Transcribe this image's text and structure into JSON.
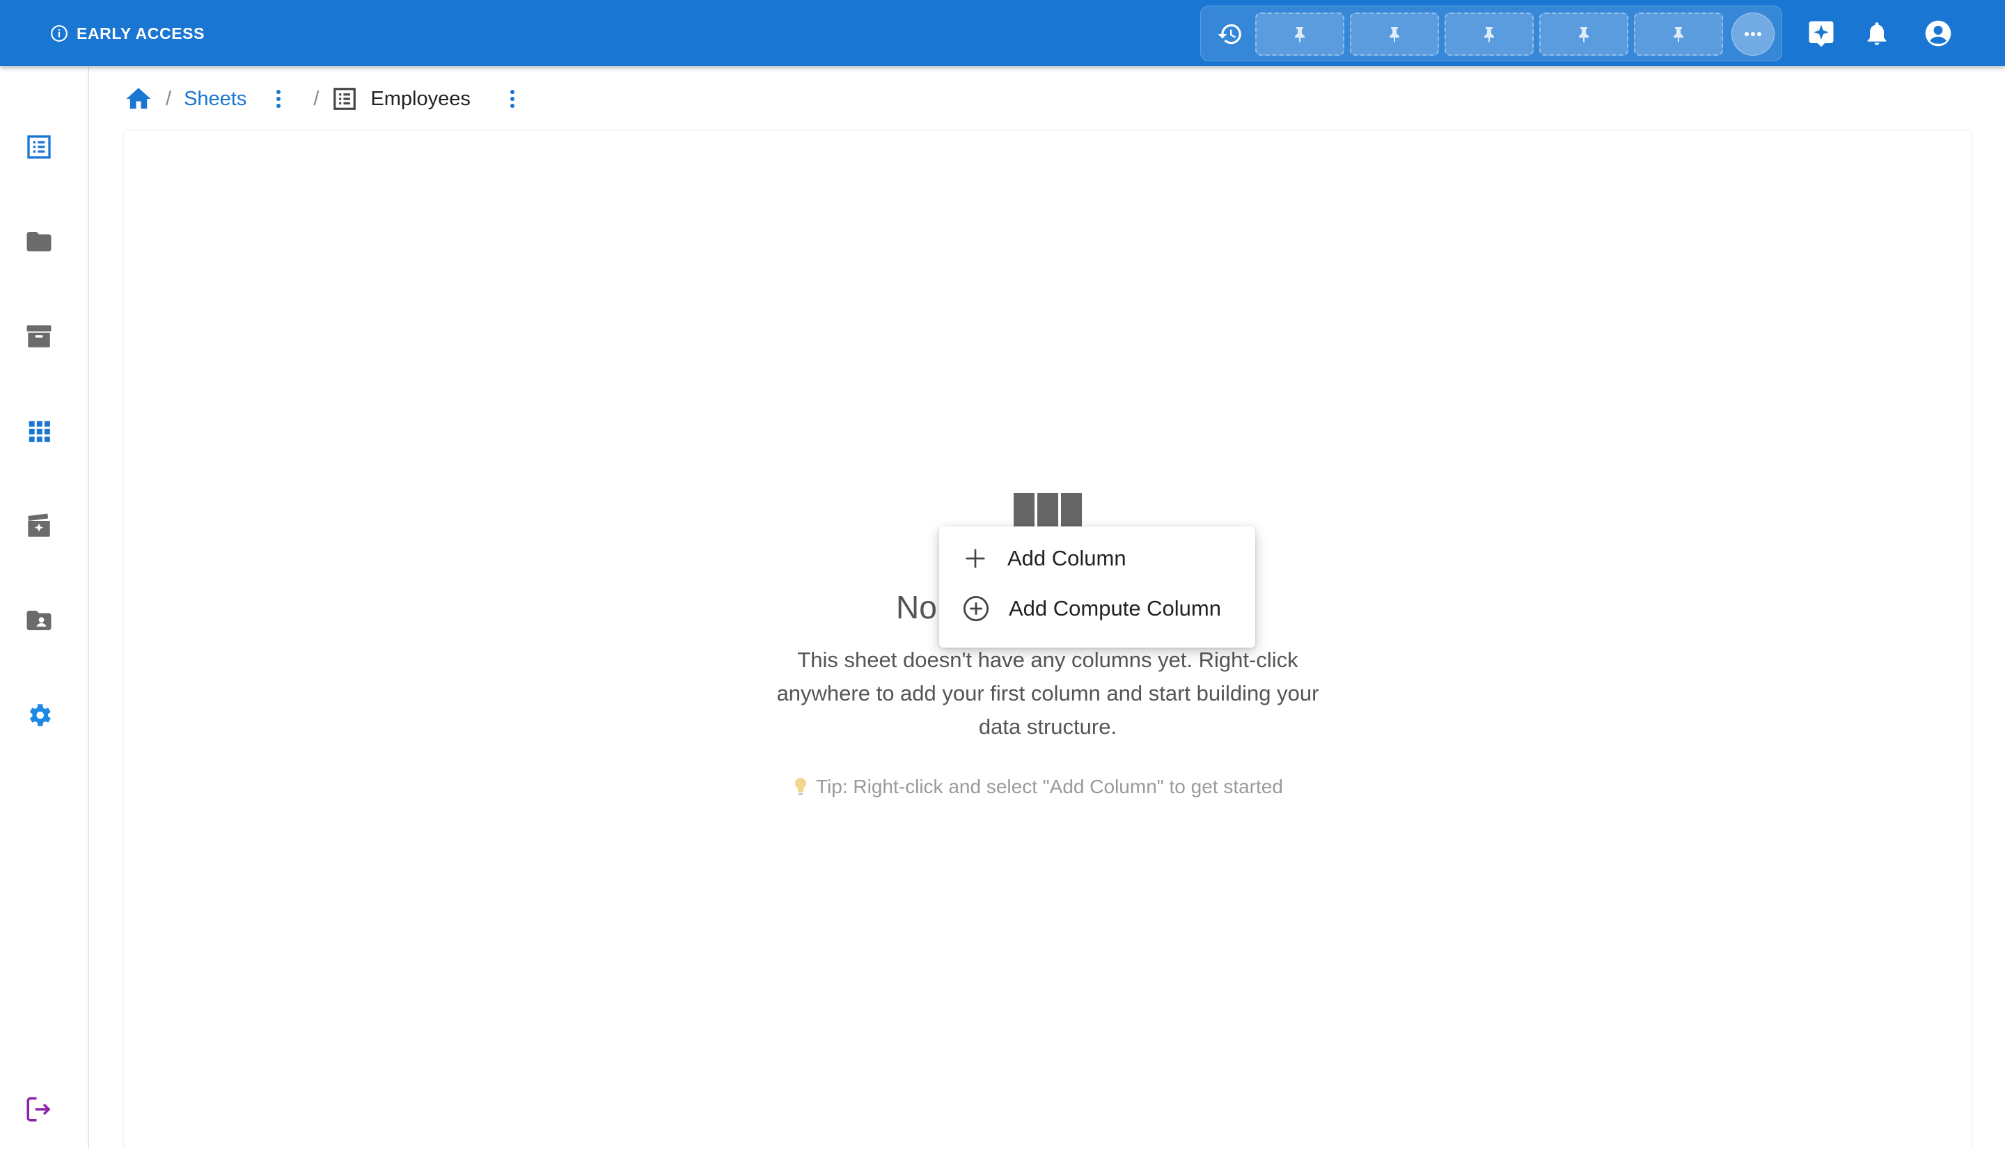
{
  "topbar": {
    "badge_label": "EARLY ACCESS",
    "accent_color": "#1976d2",
    "pin_slots": [
      "pin-icon",
      "pin-icon",
      "pin-icon",
      "pin-icon",
      "pin-icon"
    ]
  },
  "breadcrumb": {
    "root_link": "Sheets",
    "current": "Employees"
  },
  "sidebar": {
    "items": [
      "sheets-icon",
      "folder-icon",
      "archive-icon",
      "apps-grid-icon",
      "media-icon",
      "contacts-folder-icon",
      "settings-icon"
    ],
    "logout": "logout-icon"
  },
  "empty_state": {
    "title": "No",
    "description": "This sheet doesn't have any columns yet. Right-click anywhere to add your first column and start building your data structure.",
    "tip": "Tip: Right-click and select \"Add Column\" to get started"
  },
  "context_menu": {
    "items": [
      {
        "label": "Add Column",
        "icon": "plus-icon"
      },
      {
        "label": "Add Compute Column",
        "icon": "add-circle-icon"
      }
    ]
  }
}
